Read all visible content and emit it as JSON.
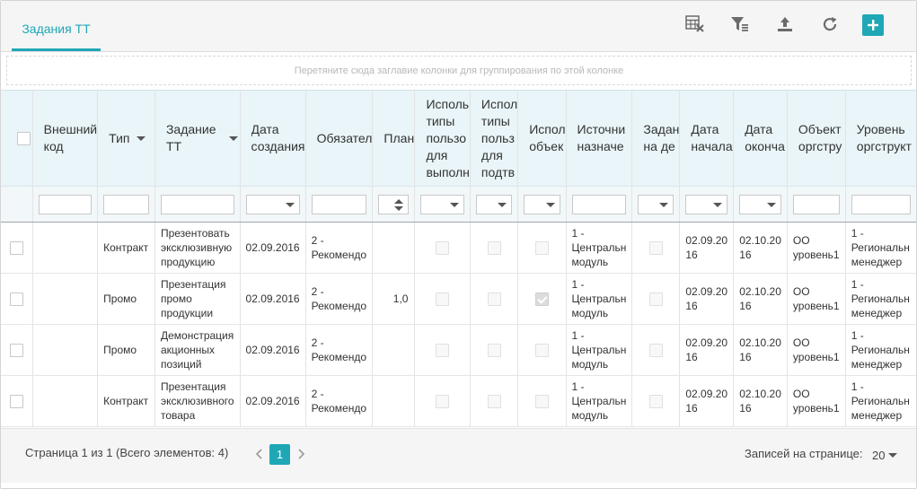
{
  "header": {
    "tab_label": "Задания ТТ"
  },
  "toolbar": {
    "icons": [
      "clear-filter-table-icon",
      "filter-icon",
      "upload-icon",
      "refresh-icon",
      "plus-icon"
    ]
  },
  "group_panel": {
    "text": "Перетяните сюда заглавие колонки для группирования по этой колонке"
  },
  "columns": [
    {
      "label": ""
    },
    {
      "label": "Внешний\nкод"
    },
    {
      "label": "Тип"
    },
    {
      "label": "Задание\nТТ"
    },
    {
      "label": "Дата\nсоздания"
    },
    {
      "label": "Обязател"
    },
    {
      "label": "План"
    },
    {
      "label": "Исполь\nтипы\nпользо\nдля\nвыполн"
    },
    {
      "label": "Испол\nтипы\nпольз\nдля\nподтв"
    },
    {
      "label": "Испол\nобъек"
    },
    {
      "label": "Источни\nназначе"
    },
    {
      "label": "Задан\nна де"
    },
    {
      "label": "Дата\nначала"
    },
    {
      "label": "Дата\nоконча"
    },
    {
      "label": "Объект\nоргстру"
    },
    {
      "label": "Уровень\nоргструкт"
    }
  ],
  "rows": [
    {
      "external_code": "",
      "type": "Контракт",
      "task": "Презентовать\nэксклюзивную\nпродукцию",
      "created": "02.09.2016",
      "required": "2 -\nРекомендо",
      "plan": "",
      "used_obj_checked": false,
      "source": "1 -\nЦентральн\nмодуль",
      "start": "02.09.20\n16",
      "end": "02.10.20\n16",
      "org_object": "ОО\nуровень1",
      "org_level": "1 -\nРегиональн\nменеджер"
    },
    {
      "external_code": "",
      "type": "Промо",
      "task": "Презентация\nпромо\nпродукции",
      "created": "02.09.2016",
      "required": "2 -\nРекомендо",
      "plan": "1,0",
      "used_obj_checked": true,
      "source": "1 -\nЦентральн\nмодуль",
      "start": "02.09.20\n16",
      "end": "02.10.20\n16",
      "org_object": "ОО\nуровень1",
      "org_level": "1 -\nРегиональн\nменеджер"
    },
    {
      "external_code": "",
      "type": "Промо",
      "task": "Демонстрация\nакционных\nпозиций",
      "created": "02.09.2016",
      "required": "2 -\nРекомендо",
      "plan": "",
      "used_obj_checked": false,
      "source": "1 -\nЦентральн\nмодуль",
      "start": "02.09.20\n16",
      "end": "02.10.20\n16",
      "org_object": "ОО\nуровень1",
      "org_level": "1 -\nРегиональн\nменеджер"
    },
    {
      "external_code": "",
      "type": "Контракт",
      "task": "Презентация\nэксклюзивного\nтовара",
      "created": "02.09.2016",
      "required": "2 -\nРекомендо",
      "plan": "",
      "used_obj_checked": false,
      "source": "1 -\nЦентральн\nмодуль",
      "start": "02.09.20\n16",
      "end": "02.10.20\n16",
      "org_object": "ОО\nуровень1",
      "org_level": "1 -\nРегиональн\nменеджер"
    }
  ],
  "pager": {
    "info": "Страница 1 из 1 (Всего элементов: 4)",
    "current_page": "1",
    "page_size_label": "Записей на странице:",
    "page_size": "20"
  },
  "colors": {
    "accent": "#1fa7b6",
    "header_bg": "#e9f5f8",
    "toolbar_icon": "#6b6b6b"
  }
}
